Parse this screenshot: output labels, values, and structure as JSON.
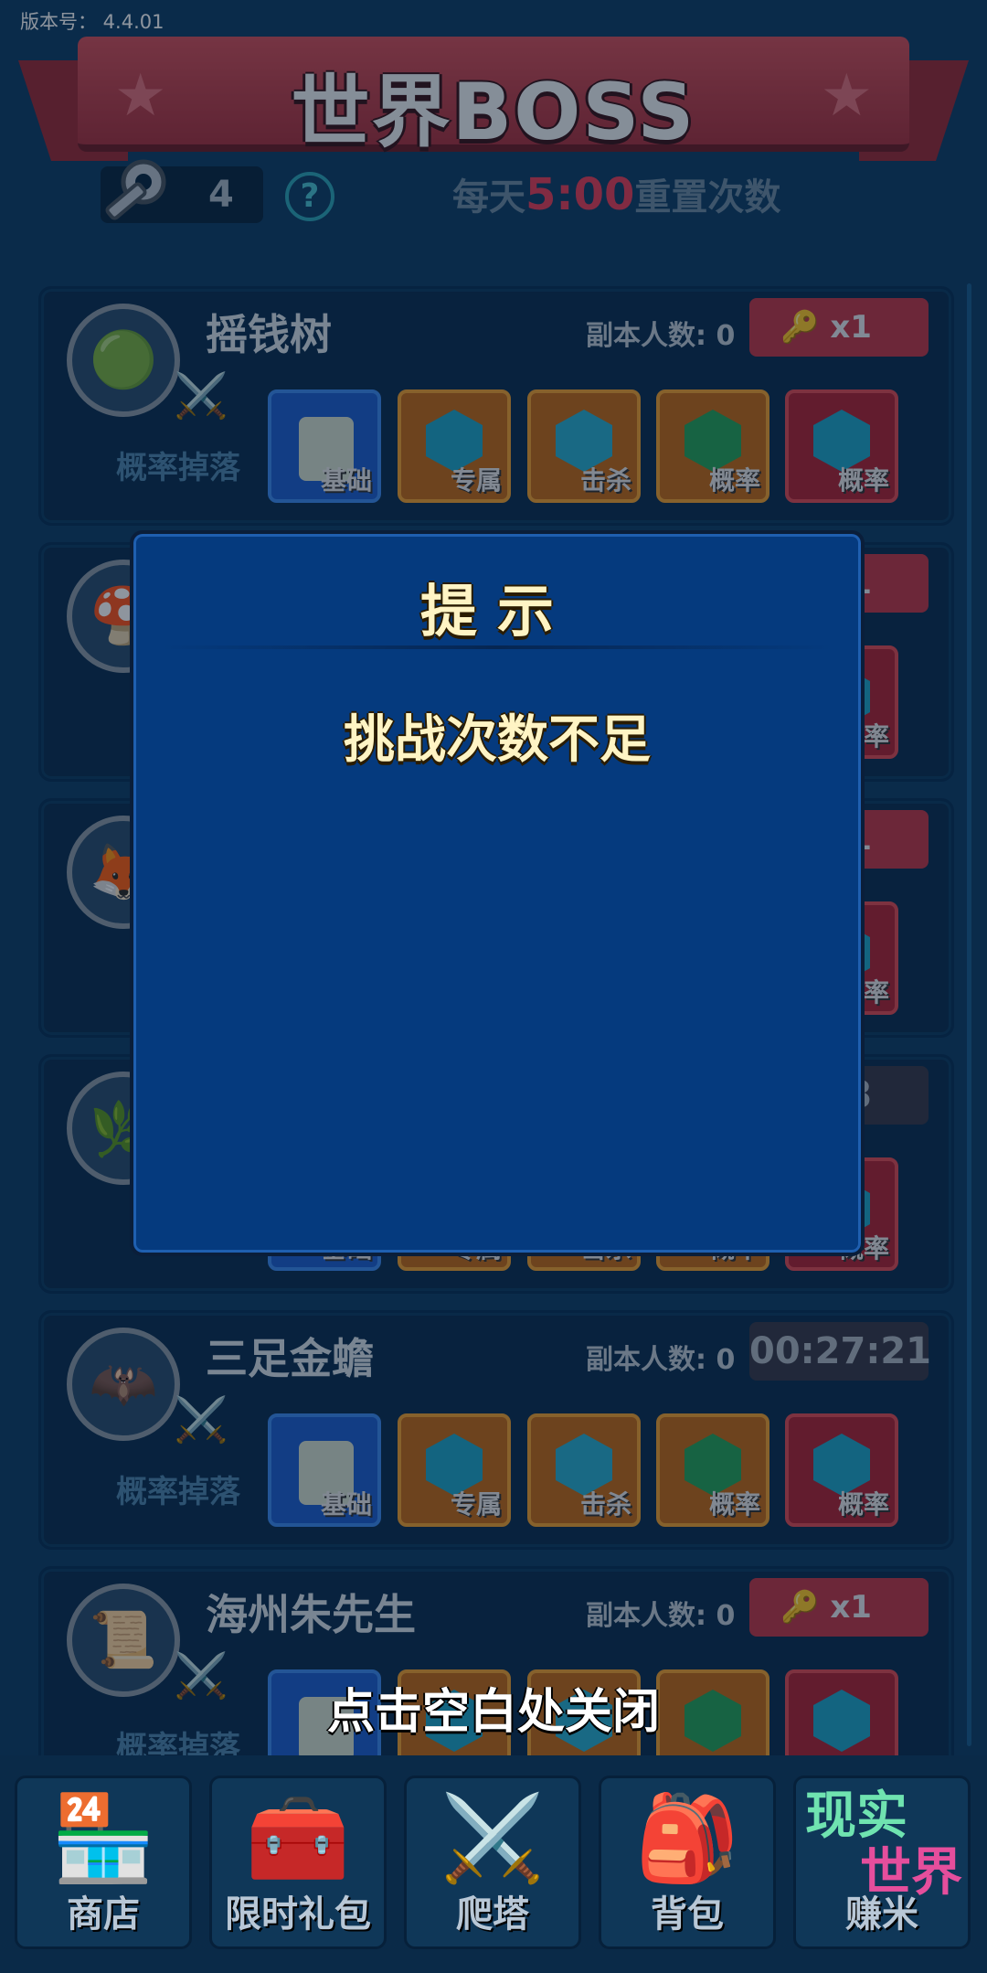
{
  "version_label": "版本号：  4.4.01",
  "banner": {
    "title": "世界BOSS"
  },
  "header": {
    "key_count": "4",
    "help_icon": "?",
    "reset_prefix": "每天",
    "reset_time": "5:00",
    "reset_suffix": "重置次数"
  },
  "bosses": [
    {
      "name": "摇钱树",
      "players": "副本人数: 0",
      "action": {
        "type": "key",
        "label": "x1"
      },
      "drop": "概率掉落",
      "items": [
        {
          "label": "基础",
          "style": "blue",
          "gem": "bag"
        },
        {
          "label": "专属",
          "style": "orange",
          "gem": "#1fa6c8"
        },
        {
          "label": "击杀",
          "style": "orange",
          "gem": "#2ab0cf"
        },
        {
          "label": "概率",
          "style": "orange",
          "gem": "#27a55a"
        },
        {
          "label": "概率",
          "style": "red",
          "gem": "#1fa6c8"
        }
      ]
    },
    {
      "name": "",
      "players": "",
      "action": {
        "type": "key",
        "label": "x1"
      },
      "drop": "",
      "items": [
        {
          "label": "",
          "style": "blue",
          "gem": "bag"
        },
        {
          "label": "",
          "style": "orange",
          "gem": "#1fa6c8"
        },
        {
          "label": "",
          "style": "orange",
          "gem": "#2ab0cf"
        },
        {
          "label": "",
          "style": "orange",
          "gem": "#27a55a"
        },
        {
          "label": "概率",
          "style": "red",
          "gem": "#1fa6c8"
        }
      ]
    },
    {
      "name": "",
      "players": "",
      "action": {
        "type": "key",
        "label": "x1"
      },
      "drop": "",
      "items": [
        {
          "label": "",
          "style": "blue",
          "gem": "bag"
        },
        {
          "label": "",
          "style": "orange",
          "gem": "#1fa6c8"
        },
        {
          "label": "",
          "style": "orange",
          "gem": "#2ab0cf"
        },
        {
          "label": "",
          "style": "orange",
          "gem": "#27a55a"
        },
        {
          "label": "概率",
          "style": "red",
          "gem": "#1fa6c8"
        }
      ]
    },
    {
      "name": "",
      "players": "",
      "action": {
        "type": "timer",
        "label": ":18"
      },
      "drop": "",
      "items": [
        {
          "label": "基础",
          "style": "blue",
          "gem": "bag"
        },
        {
          "label": "专属",
          "style": "orange",
          "gem": "#1fa6c8"
        },
        {
          "label": "击杀",
          "style": "orange",
          "gem": "#2ab0cf"
        },
        {
          "label": "概率",
          "style": "orange",
          "gem": "#27a55a"
        },
        {
          "label": "概率",
          "style": "red",
          "gem": "#1fa6c8"
        }
      ]
    },
    {
      "name": "三足金蟾",
      "players": "副本人数: 0",
      "action": {
        "type": "timer",
        "label": "00:27:21"
      },
      "drop": "概率掉落",
      "items": [
        {
          "label": "基础",
          "style": "blue",
          "gem": "bag"
        },
        {
          "label": "专属",
          "style": "orange",
          "gem": "#1fa6c8"
        },
        {
          "label": "击杀",
          "style": "orange",
          "gem": "#2ab0cf"
        },
        {
          "label": "概率",
          "style": "orange",
          "gem": "#27a55a"
        },
        {
          "label": "概率",
          "style": "red",
          "gem": "#1fa6c8"
        }
      ]
    },
    {
      "name": "海州朱先生",
      "players": "副本人数: 0",
      "action": {
        "type": "key",
        "label": "x1"
      },
      "drop": "概率掉落",
      "items": [
        {
          "label": "",
          "style": "blue",
          "gem": "bag"
        },
        {
          "label": "",
          "style": "orange",
          "gem": "#1fa6c8"
        },
        {
          "label": "",
          "style": "orange",
          "gem": "#2ab0cf"
        },
        {
          "label": "",
          "style": "orange",
          "gem": "#27a55a"
        },
        {
          "label": "",
          "style": "red",
          "gem": "#1fa6c8"
        }
      ]
    }
  ],
  "dialog": {
    "title": "提示",
    "message": "挑战次数不足"
  },
  "close_hint": "点击空白处关闭",
  "nav": [
    {
      "label": "商店",
      "icon": "shop-icon"
    },
    {
      "label": "限时礼包",
      "icon": "treasure-chest-icon"
    },
    {
      "label": "爬塔",
      "icon": "crossed-swords-icon"
    },
    {
      "label": "背包",
      "icon": "backpack-icon"
    },
    {
      "label": "赚米",
      "icon": "real-world-logo",
      "logo_text": [
        "现实",
        "世界"
      ]
    }
  ]
}
